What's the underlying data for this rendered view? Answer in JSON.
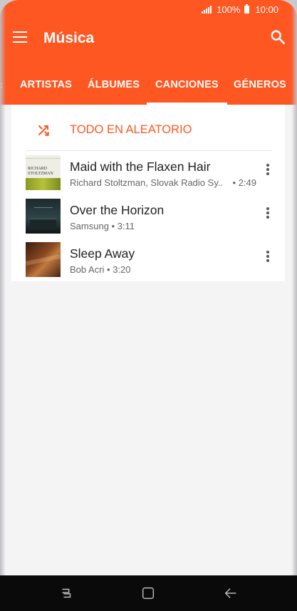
{
  "status": {
    "battery": "100%",
    "time": "10:00"
  },
  "app": {
    "title": "Música"
  },
  "tabs": [
    {
      "label": "ARTISTAS"
    },
    {
      "label": "ÁLBUMES"
    },
    {
      "label": "CANCIONES",
      "active": true
    },
    {
      "label": "GÉNEROS"
    }
  ],
  "shuffle": {
    "label": "TODO EN ALEATORIO"
  },
  "songs": [
    {
      "title": "Maid with the Flaxen Hair",
      "artist": "Richard Stoltzman, Slovak Radio Sy..",
      "duration": "• 2:49",
      "art_text": "RICHARD STOLTZMAN"
    },
    {
      "title": "Over the Horizon",
      "artist": "Samsung • 3:11"
    },
    {
      "title": "Sleep Away",
      "artist": "Bob Acri • 3:20"
    }
  ],
  "colors": {
    "accent": "#ff5722",
    "navbar": "#0a0a0a"
  },
  "icons": [
    "menu-icon",
    "search-icon",
    "shuffle-icon",
    "more-vert-icon",
    "recent-apps-icon",
    "home-icon",
    "back-icon"
  ]
}
